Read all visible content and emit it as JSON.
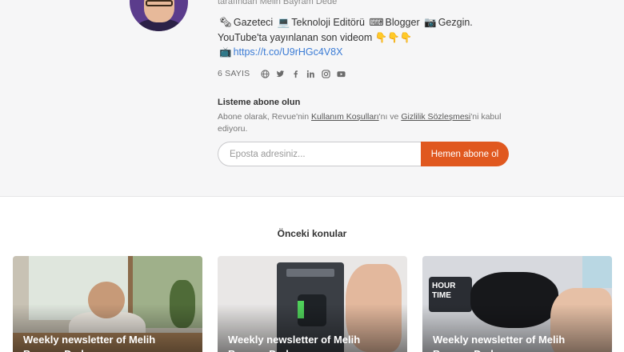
{
  "profile": {
    "byline": "tarafından Melih Bayram Dede",
    "bio": {
      "line1_items": [
        "Gazeteci",
        "Teknoloji Editörü",
        "Blogger",
        "Gezgin."
      ],
      "line1_icons": [
        "newspaper-icon",
        "laptop-icon",
        "keyboard-icon",
        "camera-icon"
      ],
      "line2_text": "YouTube'ta yayınlanan son videom",
      "line2_icons": [
        "pointing-down-icon",
        "pointing-down-icon",
        "pointing-down-icon"
      ],
      "line3_icon": "tv-icon",
      "line3_link": "https://t.co/U9rHGc4V8X"
    },
    "issue_count": "6 SAYIS",
    "social_icons": [
      "globe-icon",
      "twitter-icon",
      "facebook-icon",
      "linkedin-icon",
      "instagram-icon",
      "youtube-icon"
    ]
  },
  "subscribe": {
    "title": "Listeme abone olun",
    "desc_prefix": "Abone olarak, Revue'nin ",
    "terms_link": "Kullanım Koşulları",
    "desc_middle": "'nı ve ",
    "privacy_link": "Gizlilik Sözleşmesi",
    "desc_suffix": "'ni kabul ediyoru.",
    "email_placeholder": "Eposta adresiniz...",
    "button_label": "Hemen abone ol"
  },
  "previous": {
    "title": "Önceki konular",
    "cards": [
      {
        "title": "Weekly newsletter of Melih Bayram Dede"
      },
      {
        "title": "Weekly newsletter of Melih Bayram Dede"
      },
      {
        "title": "Weekly newsletter of Melih Bayram Dede"
      }
    ],
    "card3_image_text": "HOUR TIME"
  },
  "colors": {
    "accent": "#e0581f",
    "link": "#3a7bd5",
    "background_top": "#f6f6f7"
  }
}
